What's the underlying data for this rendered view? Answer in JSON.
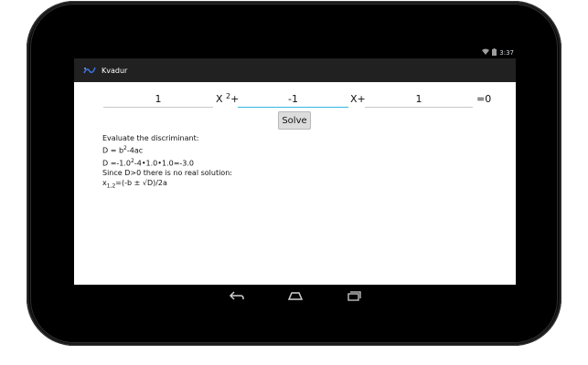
{
  "status": {
    "time": "3:37"
  },
  "actionbar": {
    "title": "Kvadur"
  },
  "equation": {
    "a_value": "1",
    "x2_label": "X",
    "x2_sup": "2",
    "x2_plus": "+",
    "b_value": "-1",
    "x_label": "X+",
    "c_value": "1",
    "equals_zero": "=0"
  },
  "solve_button": {
    "label": "Solve"
  },
  "output": {
    "line1": "Evaluate the discriminant:",
    "line2_pre": "D = b",
    "line2_sup": "2",
    "line2_post": "-4ac",
    "line3_pre": "D =-1.0",
    "line3_sup": "2",
    "line3_post": "-4•1.0•1.0=-3.0",
    "line4": "Since D>0 there is no real solution:",
    "line5_pre": "x",
    "line5_sub": "1,2",
    "line5_post": "=(-b ± √D)/2a"
  },
  "icons": {
    "app": "kvadur-app-icon",
    "wifi": "wifi-icon",
    "battery": "battery-icon",
    "back": "back-icon",
    "home": "home-icon",
    "recents": "recents-icon"
  }
}
